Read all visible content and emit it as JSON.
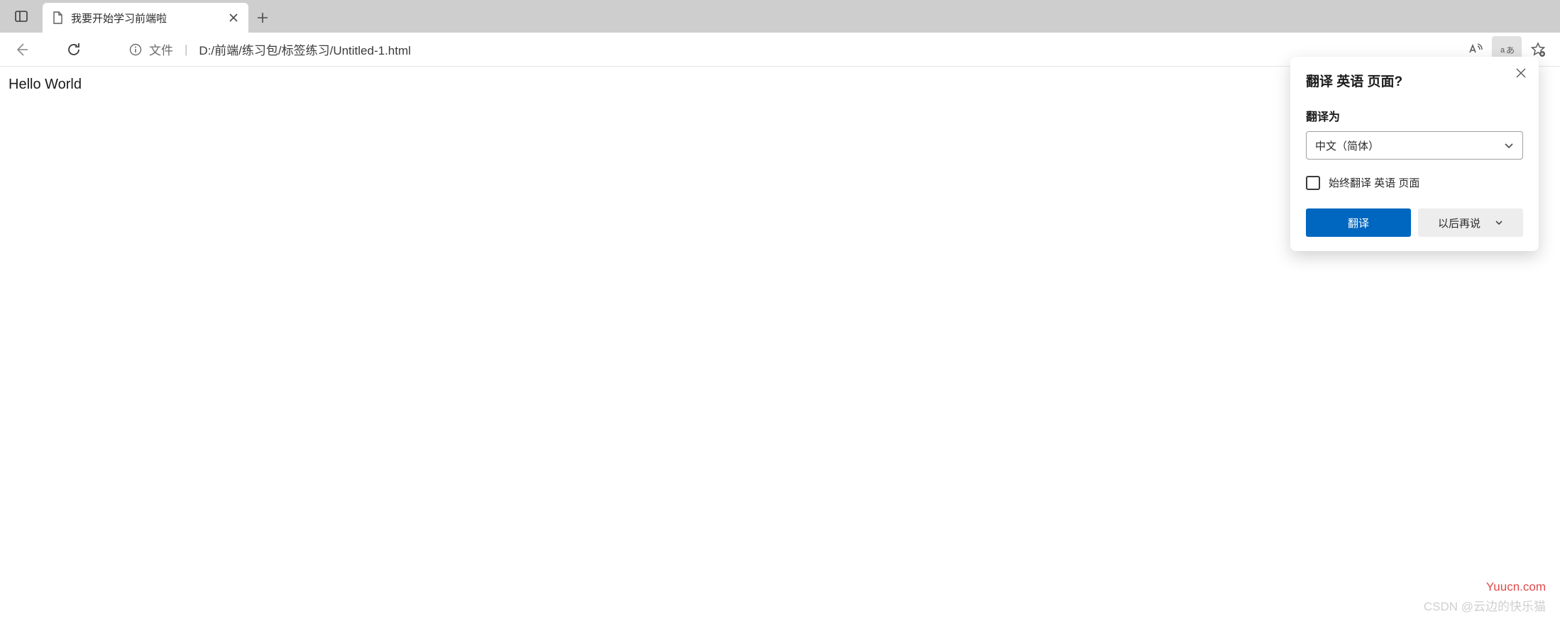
{
  "tab": {
    "title": "我要开始学习前端啦"
  },
  "address": {
    "scheme": "文件",
    "path": "D:/前端/练习包/标签练习/Untitled-1.html"
  },
  "page": {
    "body_text": "Hello World"
  },
  "translate_popup": {
    "title": "翻译 英语 页面?",
    "translate_to_label": "翻译为",
    "selected_language": "中文（简体）",
    "always_translate_label": "始终翻译 英语 页面",
    "translate_button": "翻译",
    "later_button": "以后再说"
  },
  "watermark": {
    "site": "Yuucn.com",
    "csdn": "CSDN @云边的快乐猫"
  }
}
